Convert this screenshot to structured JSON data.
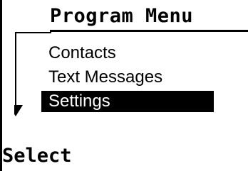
{
  "header": {
    "title": "Program Menu"
  },
  "menu": {
    "items": [
      {
        "label": "Contacts",
        "selected": false
      },
      {
        "label": "Text Messages",
        "selected": false
      },
      {
        "label": "Settings",
        "selected": true
      }
    ],
    "scroll_indicator_icon": "down-arrow-icon"
  },
  "softkeys": {
    "left_label": "Select"
  },
  "colors": {
    "background": "#ffffff",
    "foreground": "#000000",
    "highlight": "#000000",
    "highlight_text": "#ffffff"
  }
}
